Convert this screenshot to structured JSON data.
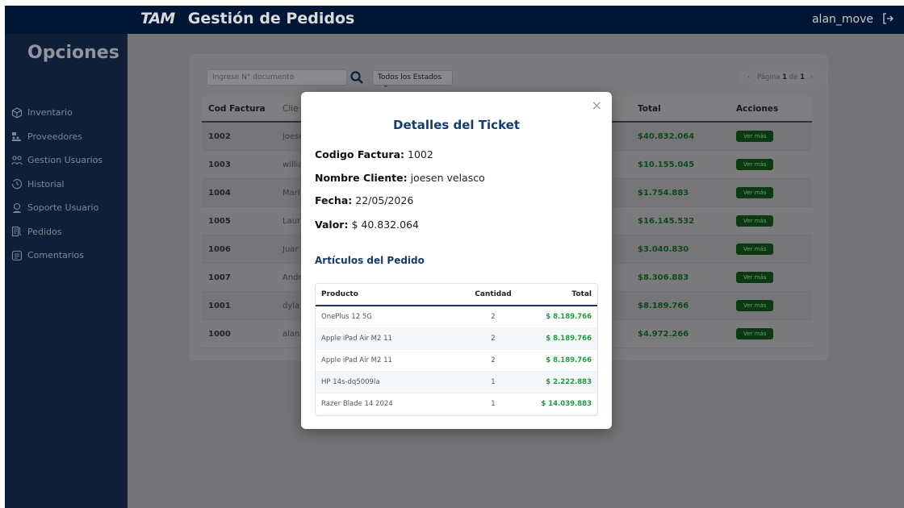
{
  "header": {
    "logo": "TAM",
    "title": "Gestión de Pedidos",
    "user": "alan_move"
  },
  "sidebar": {
    "title": "Opciones",
    "items": [
      {
        "label": "Inventario",
        "icon": "cube-icon"
      },
      {
        "label": "Proveedores",
        "icon": "suppliers-icon"
      },
      {
        "label": "Gestion Usuarios",
        "icon": "users-icon"
      },
      {
        "label": "Historial",
        "icon": "history-icon"
      },
      {
        "label": "Soporte Usuario",
        "icon": "support-icon"
      },
      {
        "label": "Pedidos",
        "icon": "orders-icon"
      },
      {
        "label": "Comentarios",
        "icon": "comments-icon"
      }
    ]
  },
  "toolbar": {
    "search_placeholder": "Ingrese N° documento",
    "status_selected": "Todos los Estados",
    "pager_prefix": "Página",
    "pager_current": "1",
    "pager_mid": "de",
    "pager_total": "1"
  },
  "table": {
    "headers": {
      "cod": "Cod Factura",
      "cli": "Clie",
      "total": "Total",
      "acciones": "Acciones"
    },
    "action_label": "Ver más",
    "rows": [
      {
        "cod": "1002",
        "cli": "joese",
        "total": "$40.832.064"
      },
      {
        "cod": "1003",
        "cli": "willia",
        "total": "$10.155.045"
      },
      {
        "cod": "1004",
        "cli": "Mari",
        "total": "$1.754.883"
      },
      {
        "cod": "1005",
        "cli": "Laur",
        "total": "$16.145.532"
      },
      {
        "cod": "1006",
        "cli": "Juar",
        "total": "$3.040.830"
      },
      {
        "cod": "1007",
        "cli": "Andr",
        "total": "$8.306.883"
      },
      {
        "cod": "1001",
        "cli": "dyla",
        "total": "$8.189.766"
      },
      {
        "cod": "1000",
        "cli": "alan",
        "total": "$4.972.266"
      }
    ]
  },
  "modal": {
    "title": "Detalles del Ticket",
    "close": "×",
    "fields": {
      "codigo_label": "Codigo Factura:",
      "codigo": "1002",
      "cliente_label": "Nombre Cliente:",
      "cliente": "joesen velasco",
      "fecha_label": "Fecha:",
      "fecha": "22/05/2026",
      "valor_label": "Valor:",
      "valor": "$ 40.832.064"
    },
    "items_title": "Artículos del Pedido",
    "items_headers": {
      "producto": "Producto",
      "cantidad": "Cantidad",
      "total": "Total"
    },
    "items": [
      {
        "producto": "OnePlus 12 5G",
        "cantidad": "2",
        "total": "$ 8.189.766"
      },
      {
        "producto": "Apple iPad Air M2 11",
        "cantidad": "2",
        "total": "$ 8.189.766"
      },
      {
        "producto": "Apple iPad Air M2 11",
        "cantidad": "2",
        "total": "$ 8.189.766"
      },
      {
        "producto": "HP 14s-dq5009la",
        "cantidad": "1",
        "total": "$ 2.222.883"
      },
      {
        "producto": "Razer Blade 14 2024",
        "cantidad": "1",
        "total": "$ 14.039.883"
      }
    ]
  }
}
